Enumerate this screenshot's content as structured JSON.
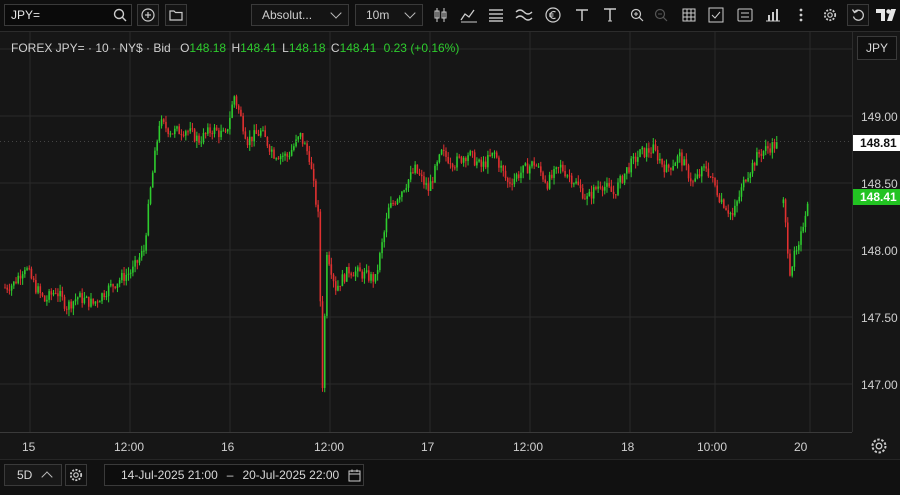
{
  "toolbar": {
    "symbol": "JPY=",
    "chart_style": "Absolut...",
    "interval": "10m",
    "icons": [
      "search-icon",
      "add-circle-icon",
      "folder-icon",
      "candles-icon",
      "indicators-icon",
      "bars-icon",
      "waves-icon",
      "euro-circle-icon",
      "text-t-icon",
      "zoom-in-icon",
      "zoom-out-icon",
      "table-icon",
      "crosshair-box-icon",
      "news-icon",
      "chart-bars-icon",
      "more-vertical-icon",
      "gear-icon",
      "undo-icon",
      "tradingview-logo"
    ]
  },
  "legend": {
    "instrument": "FOREX JPY= · 10 · NY$ · Bid",
    "o_label": "O",
    "o_value": "148.18",
    "h_label": "H",
    "h_value": "148.41",
    "l_label": "L",
    "l_value": "148.18",
    "c_label": "C",
    "c_value": "148.41",
    "change": "0.23 (+0.16%)"
  },
  "price_axis": {
    "currency": "JPY",
    "ticks": [
      "149.00",
      "148.50",
      "148.00",
      "147.50",
      "147.00"
    ],
    "marker_prev": "148.81",
    "marker_last": "148.41"
  },
  "time_axis": {
    "labels": [
      "15",
      "12:00",
      "16",
      "12:00",
      "17",
      "12:00",
      "18",
      "10:00",
      "20"
    ]
  },
  "bottom": {
    "range": "5D",
    "from": "14-Jul-2025 21:00",
    "separator": "–",
    "to": "20-Jul-2025 22:00"
  },
  "colors": {
    "up": "#2ecc2e",
    "down": "#e03030",
    "grid": "#2a2a2a",
    "last_price_box": "#22c322",
    "prev_price_box": "#ffffff"
  },
  "chart_data": {
    "type": "candlestick",
    "ylim": [
      146.9,
      149.3
    ],
    "x_labels": [
      "15",
      "12:00",
      "16",
      "12:00",
      "17",
      "12:00",
      "18",
      "10:00",
      "20"
    ],
    "session_anchors_close": [
      [
        0,
        147.72
      ],
      [
        4,
        147.75
      ],
      [
        9,
        147.88
      ],
      [
        14,
        147.72
      ],
      [
        18,
        147.62
      ],
      [
        23,
        147.7
      ],
      [
        28,
        147.58
      ],
      [
        33,
        147.65
      ],
      [
        40,
        147.6
      ],
      [
        46,
        147.7
      ],
      [
        52,
        147.78
      ],
      [
        58,
        147.85
      ],
      [
        63,
        148.0
      ],
      [
        66,
        148.45
      ],
      [
        70,
        148.95
      ],
      [
        76,
        148.88
      ],
      [
        82,
        148.9
      ],
      [
        88,
        148.82
      ],
      [
        94,
        148.9
      ],
      [
        100,
        148.85
      ],
      [
        104,
        149.15
      ],
      [
        110,
        148.82
      ],
      [
        116,
        148.88
      ],
      [
        122,
        148.72
      ],
      [
        128,
        148.7
      ],
      [
        134,
        148.85
      ],
      [
        138,
        148.7
      ],
      [
        142,
        148.25
      ],
      [
        144,
        147.0
      ],
      [
        146,
        148.0
      ],
      [
        150,
        147.72
      ],
      [
        156,
        147.85
      ],
      [
        162,
        147.82
      ],
      [
        168,
        147.78
      ],
      [
        174,
        148.3
      ],
      [
        180,
        148.45
      ],
      [
        186,
        148.6
      ],
      [
        192,
        148.45
      ],
      [
        198,
        148.72
      ],
      [
        204,
        148.65
      ],
      [
        210,
        148.72
      ],
      [
        216,
        148.62
      ],
      [
        222,
        148.72
      ],
      [
        228,
        148.5
      ],
      [
        234,
        148.58
      ],
      [
        240,
        148.65
      ],
      [
        246,
        148.5
      ],
      [
        252,
        148.62
      ],
      [
        258,
        148.52
      ],
      [
        264,
        148.38
      ],
      [
        270,
        148.5
      ],
      [
        276,
        148.42
      ],
      [
        282,
        148.6
      ],
      [
        288,
        148.72
      ],
      [
        294,
        148.75
      ],
      [
        300,
        148.6
      ],
      [
        306,
        148.7
      ],
      [
        312,
        148.5
      ],
      [
        318,
        148.62
      ],
      [
        324,
        148.4
      ],
      [
        330,
        148.25
      ],
      [
        336,
        148.55
      ],
      [
        342,
        148.72
      ],
      [
        348,
        148.78
      ],
      [
        350,
        148.78
      ]
    ],
    "gap_anchors_close": [
      [
        353,
        148.35
      ],
      [
        356,
        147.85
      ],
      [
        358,
        147.95
      ],
      [
        360,
        148.0
      ],
      [
        362,
        148.2
      ],
      [
        364,
        148.38
      ]
    ]
  }
}
